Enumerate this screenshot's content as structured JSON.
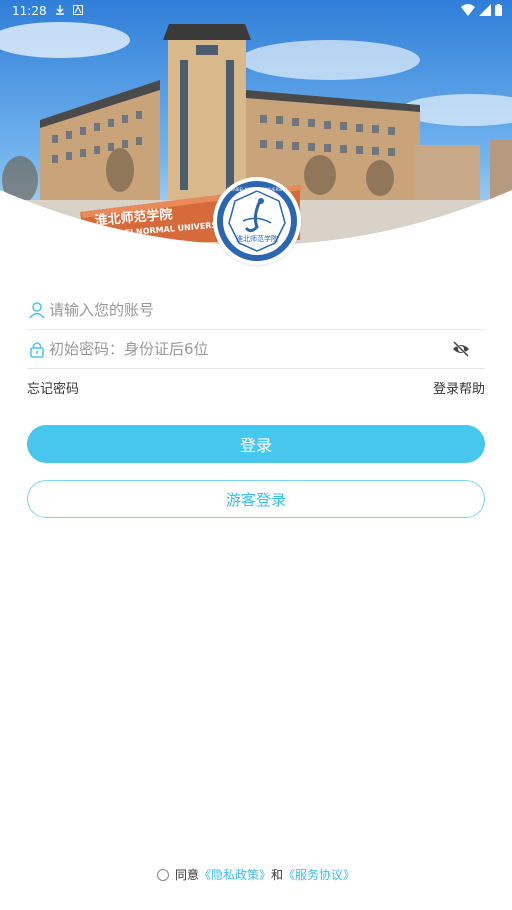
{
  "status_bar": {
    "time": "11:28"
  },
  "banner": {
    "sign_text_cn": "淮北师范学院",
    "sign_text_en": "HUAIBEI NORMAL UNIVERSITY"
  },
  "emblem": {
    "text_cn": "淮北师范学院",
    "text_en": "HUAIBEI NORMAL UNIVERSITY"
  },
  "login": {
    "account_placeholder": "请输入您的账号",
    "password_placeholder": "初始密码：身份证后6位",
    "forgot_password": "忘记密码",
    "login_help": "登录帮助",
    "login_button": "登录",
    "guest_button": "游客登录"
  },
  "agreement": {
    "prefix": "同意",
    "privacy_link": "《隐私政策》",
    "and": "和",
    "service_link": "《服务协议》"
  },
  "colors": {
    "accent": "#48c7ee",
    "link": "#3bbfea"
  }
}
